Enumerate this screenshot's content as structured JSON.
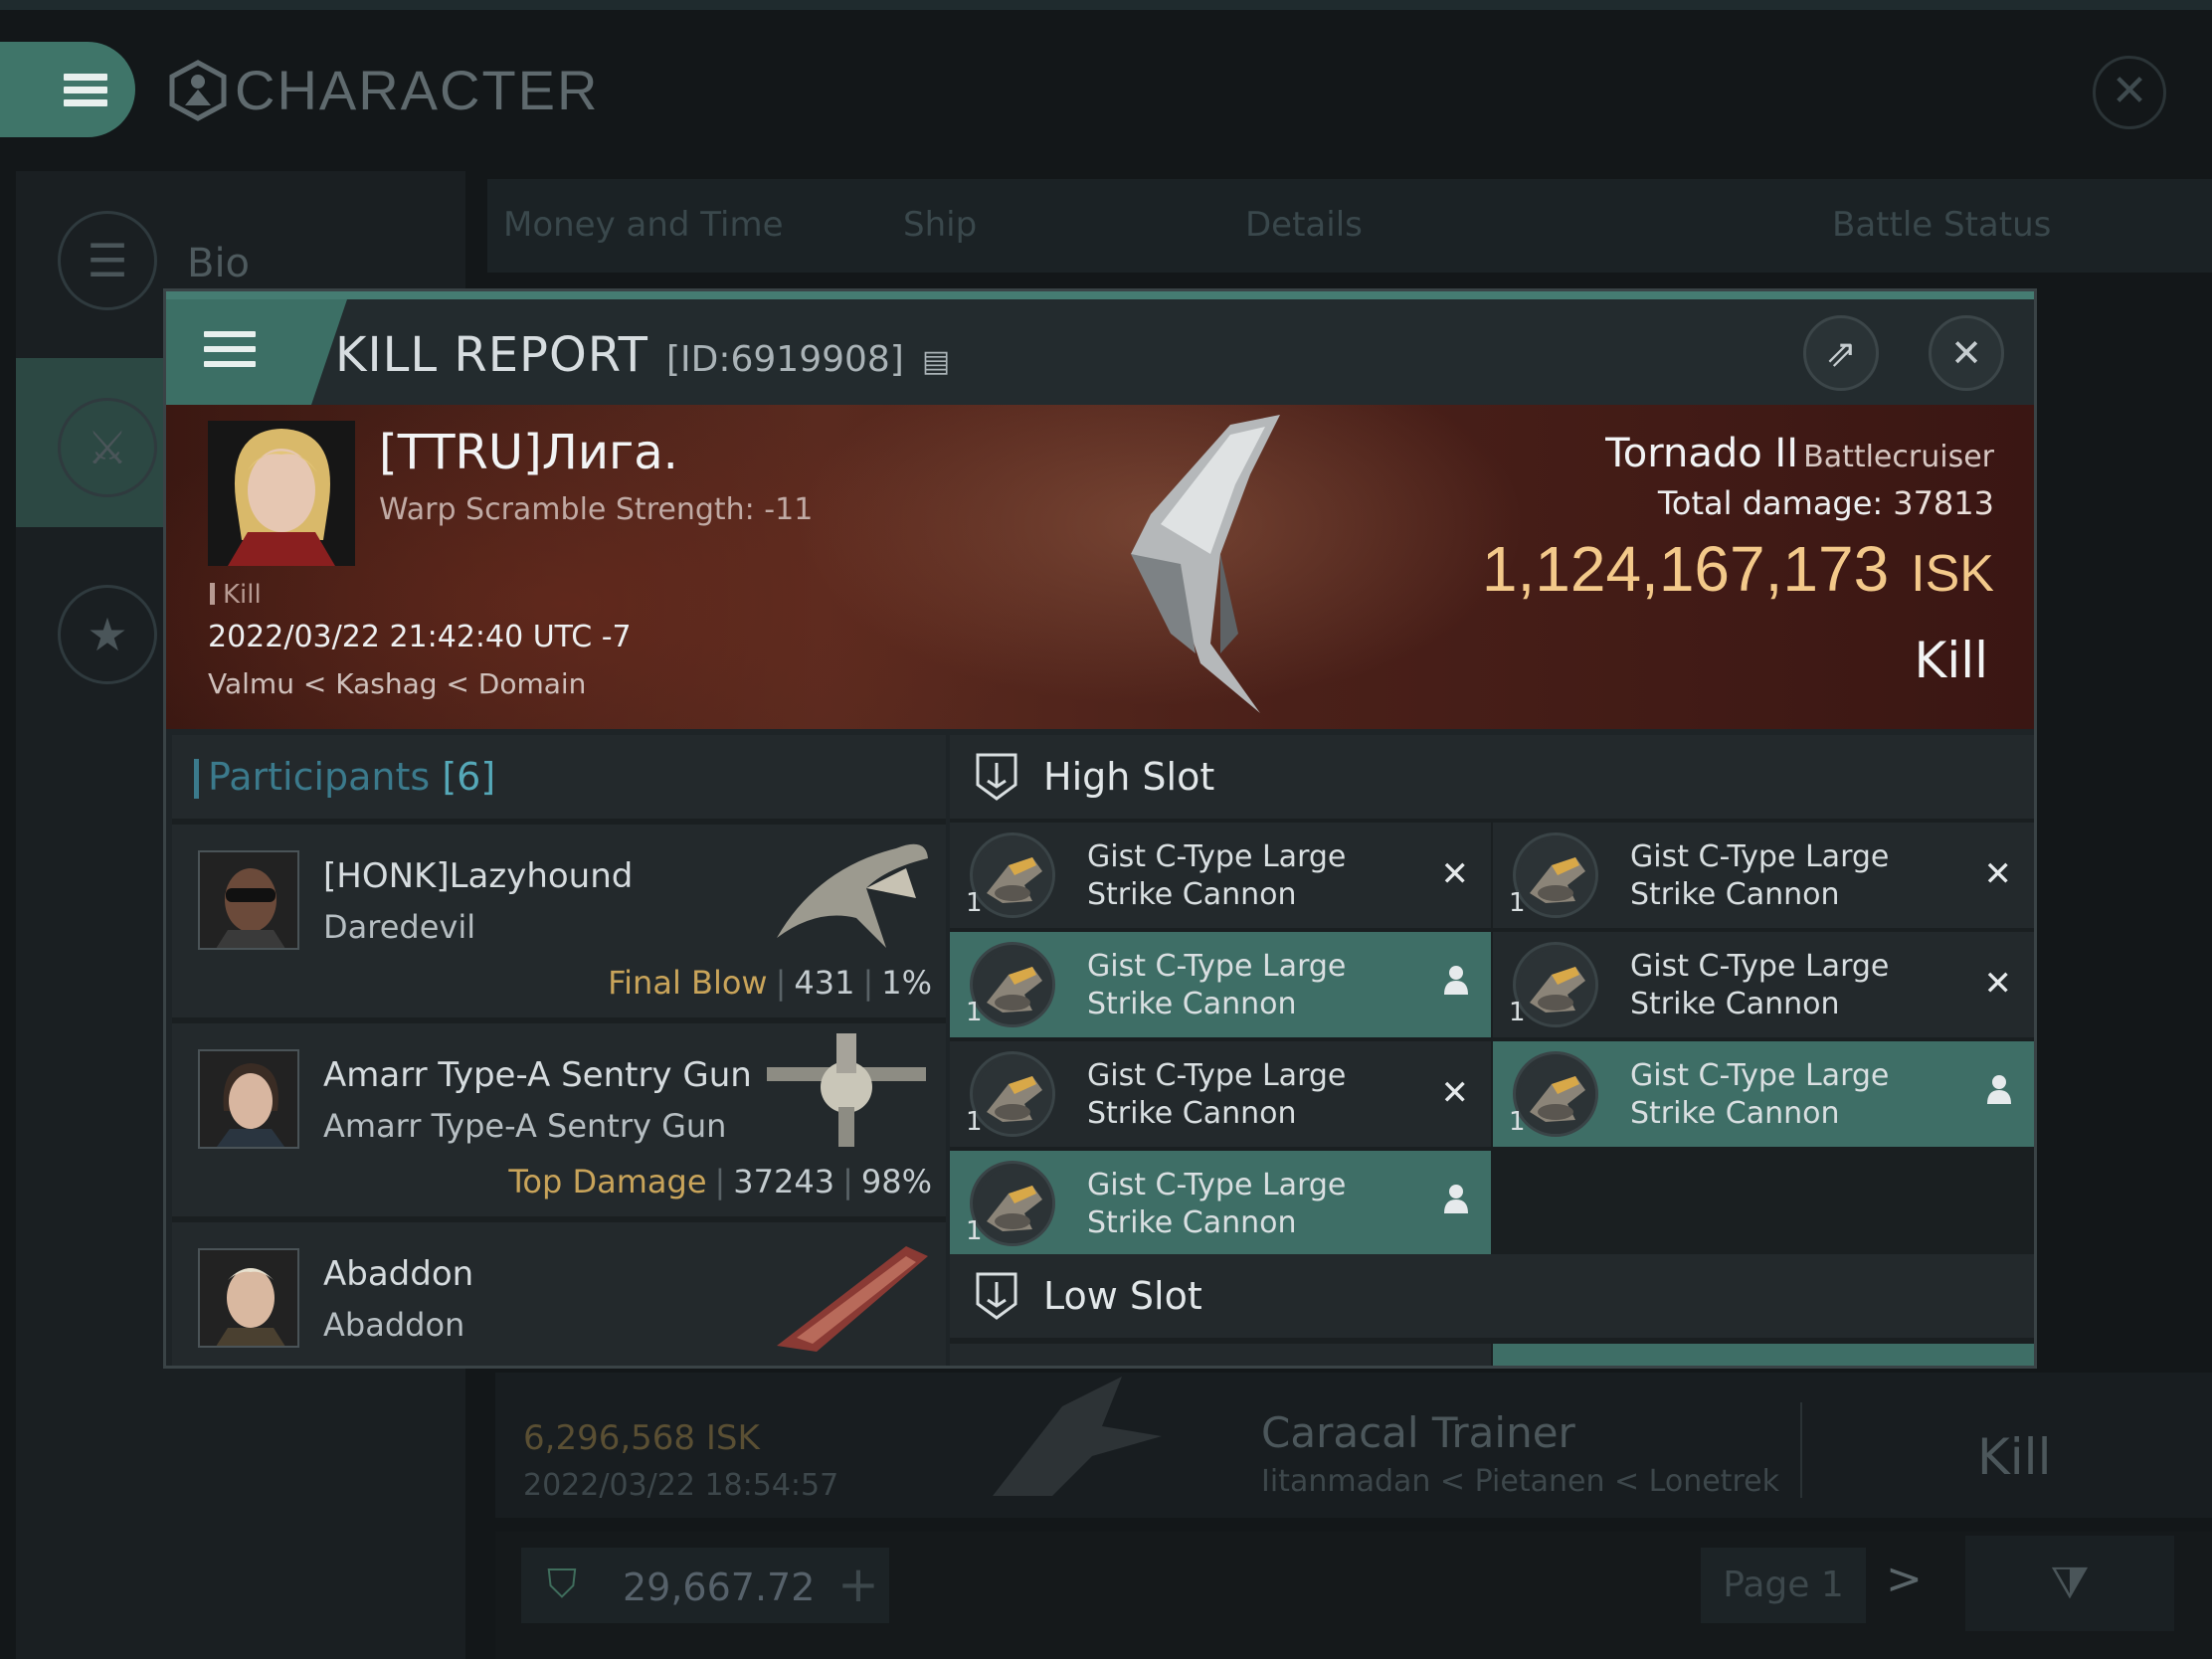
{
  "background": {
    "window_title": "CHARACTER",
    "sidebar": [
      {
        "label": "Bio",
        "icon": "menu-icon"
      },
      {
        "label": "",
        "icon": "crossed-swords-icon"
      },
      {
        "label": "",
        "icon": "star-badge-icon"
      }
    ],
    "tabs": [
      "Money and Time",
      "Ship",
      "Details",
      "Battle Status"
    ],
    "row": {
      "isk": "6,296,568",
      "isk_unit": "ISK",
      "date": "2022/03/22  18:54:57",
      "ship": "Caracal Trainer",
      "location": "Iitanmadan < Pietanen < Lonetrek",
      "result": "Kill"
    },
    "wallet": "29,667.72",
    "page": "Page 1"
  },
  "dialog": {
    "title": "KILL REPORT",
    "id": "[ID:6919908]",
    "victim": {
      "name": "[TTRU]Лига.",
      "warp_scramble": "Warp Scramble Strength: -11",
      "tag": "Kill",
      "datetime": "2022/03/22 21:42:40 UTC -7",
      "location": "Valmu < Kashag < Domain"
    },
    "ship": {
      "name": "Tornado II",
      "class": "Battlecruiser",
      "total_damage_label": "Total damage:",
      "total_damage": "37813",
      "isk": "1,124,167,173",
      "isk_unit": "ISK",
      "result": "Kill"
    },
    "participants": {
      "label": "Participants",
      "count": "[6]",
      "rows": [
        {
          "name": "[HONK]Lazyhound",
          "ship": "Daredevil",
          "tag": "Final Blow",
          "damage": "431",
          "pct": "1%"
        },
        {
          "name": "Amarr Type-A Sentry Gun",
          "ship": "Amarr Type-A Sentry Gun",
          "tag": "Top Damage",
          "damage": "37243",
          "pct": "98%"
        },
        {
          "name": "Abaddon",
          "ship": "Abaddon",
          "tag": "",
          "damage": "",
          "pct": ""
        }
      ]
    },
    "high_slot_label": "High Slot",
    "low_slot_label": "Low Slot",
    "high_modules": [
      {
        "name1": "Gist C-Type Large",
        "name2": "Strike Cannon",
        "qty": "1",
        "status": "destroyed"
      },
      {
        "name1": "Gist C-Type Large",
        "name2": "Strike Cannon",
        "qty": "1",
        "status": "destroyed"
      },
      {
        "name1": "Gist C-Type Large",
        "name2": "Strike Cannon",
        "qty": "1",
        "status": "dropped"
      },
      {
        "name1": "Gist C-Type Large",
        "name2": "Strike Cannon",
        "qty": "1",
        "status": "destroyed"
      },
      {
        "name1": "Gist C-Type Large",
        "name2": "Strike Cannon",
        "qty": "1",
        "status": "destroyed"
      },
      {
        "name1": "Gist C-Type Large",
        "name2": "Strike Cannon",
        "qty": "1",
        "status": "dropped"
      },
      {
        "name1": "Gist C-Type Large",
        "name2": "Strike Cannon",
        "qty": "1",
        "status": "dropped"
      }
    ],
    "colors": {
      "accent": "#3e6e66",
      "isk": "#f3c98a",
      "participants": "#3b7a8c",
      "tag": "#c9a45a"
    }
  }
}
